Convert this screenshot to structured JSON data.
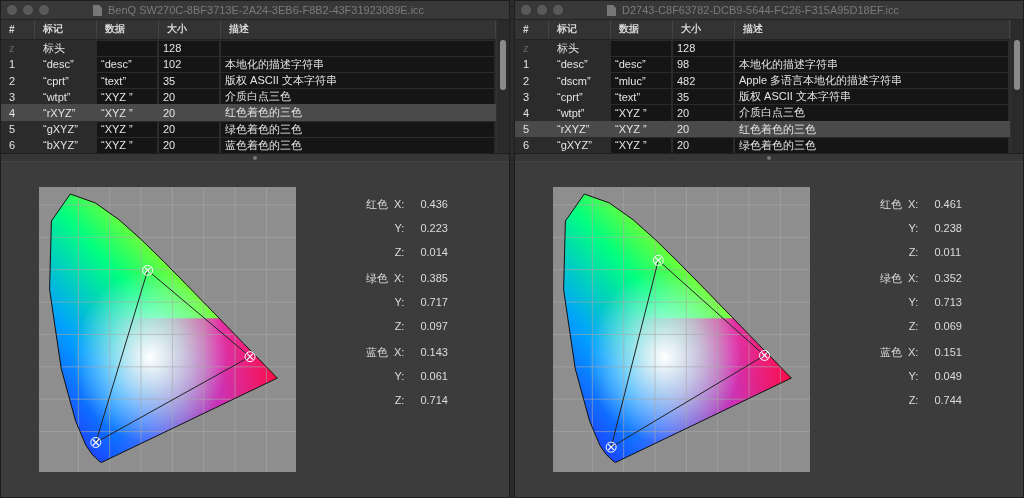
{
  "windows": [
    {
      "title": "BenQ SW270C-8BF3713E-2A24-3EB6-F8B2-43F31923089E.icc",
      "table": {
        "columns": [
          "#",
          "标记",
          "数据",
          "大小",
          "描述"
        ],
        "rows": [
          {
            "kind": "header",
            "index": "z",
            "tag": "标头",
            "data": "",
            "size": "128",
            "description": "",
            "selected": false
          },
          {
            "kind": "tag",
            "index": "1",
            "tag": "“desc”",
            "data": "“desc”",
            "size": "102",
            "description": "本地化的描述字符串",
            "selected": false
          },
          {
            "kind": "tag",
            "index": "2",
            "tag": "“cprt”",
            "data": "“text”",
            "size": "35",
            "description": "版权 ASCII 文本字符串",
            "selected": false
          },
          {
            "kind": "tag",
            "index": "3",
            "tag": "“wtpt”",
            "data": "“XYZ ”",
            "size": "20",
            "description": "介质白点三色",
            "selected": false
          },
          {
            "kind": "tag",
            "index": "4",
            "tag": "“rXYZ”",
            "data": "“XYZ ”",
            "size": "20",
            "description": "红色着色的三色",
            "selected": true
          },
          {
            "kind": "tag",
            "index": "5",
            "tag": "“gXYZ”",
            "data": "“XYZ ”",
            "size": "20",
            "description": "绿色着色的三色",
            "selected": false
          },
          {
            "kind": "tag",
            "index": "6",
            "tag": "“bXYZ”",
            "data": "“XYZ ”",
            "size": "20",
            "description": "蓝色着色的三色",
            "selected": false
          }
        ]
      },
      "primaries": [
        {
          "label": "红色",
          "values": [
            {
              "axis": "X:",
              "value": "0.436"
            },
            {
              "axis": "Y:",
              "value": "0.223"
            },
            {
              "axis": "Z:",
              "value": "0.014"
            }
          ]
        },
        {
          "label": "绿色",
          "values": [
            {
              "axis": "X:",
              "value": "0.385"
            },
            {
              "axis": "Y:",
              "value": "0.717"
            },
            {
              "axis": "Z:",
              "value": "0.097"
            }
          ]
        },
        {
          "label": "蓝色",
          "values": [
            {
              "axis": "X:",
              "value": "0.143"
            },
            {
              "axis": "Y:",
              "value": "0.061"
            },
            {
              "axis": "Z:",
              "value": "0.714"
            }
          ]
        }
      ]
    },
    {
      "title": "D2743-C8F63782-DCB9-5644-FC26-F315A95D18EF.icc",
      "table": {
        "columns": [
          "#",
          "标记",
          "数据",
          "大小",
          "描述"
        ],
        "rows": [
          {
            "kind": "header",
            "index": "z",
            "tag": "标头",
            "data": "",
            "size": "128",
            "description": "",
            "selected": false
          },
          {
            "kind": "tag",
            "index": "1",
            "tag": "“desc”",
            "data": "“desc”",
            "size": "98",
            "description": "本地化的描述字符串",
            "selected": false
          },
          {
            "kind": "tag",
            "index": "2",
            "tag": "“dscm”",
            "data": "“mluc”",
            "size": "482",
            "description": "Apple 多语言本地化的描述字符串",
            "selected": false
          },
          {
            "kind": "tag",
            "index": "3",
            "tag": "“cprt”",
            "data": "“text”",
            "size": "35",
            "description": "版权 ASCII 文本字符串",
            "selected": false
          },
          {
            "kind": "tag",
            "index": "4",
            "tag": "“wtpt”",
            "data": "“XYZ ”",
            "size": "20",
            "description": "介质白点三色",
            "selected": false
          },
          {
            "kind": "tag",
            "index": "5",
            "tag": "“rXYZ”",
            "data": "“XYZ ”",
            "size": "20",
            "description": "红色着色的三色",
            "selected": true
          },
          {
            "kind": "tag",
            "index": "6",
            "tag": "“gXYZ”",
            "data": "“XYZ ”",
            "size": "20",
            "description": "绿色着色的三色",
            "selected": false
          }
        ]
      },
      "primaries": [
        {
          "label": "红色",
          "values": [
            {
              "axis": "X:",
              "value": "0.461"
            },
            {
              "axis": "Y:",
              "value": "0.238"
            },
            {
              "axis": "Z:",
              "value": "0.011"
            }
          ]
        },
        {
          "label": "绿色",
          "values": [
            {
              "axis": "X:",
              "value": "0.352"
            },
            {
              "axis": "Y:",
              "value": "0.713"
            },
            {
              "axis": "Z:",
              "value": "0.069"
            }
          ]
        },
        {
          "label": "蓝色",
          "values": [
            {
              "axis": "X:",
              "value": "0.151"
            },
            {
              "axis": "Y:",
              "value": "0.049"
            },
            {
              "axis": "Z:",
              "value": "0.744"
            }
          ]
        }
      ]
    }
  ]
}
